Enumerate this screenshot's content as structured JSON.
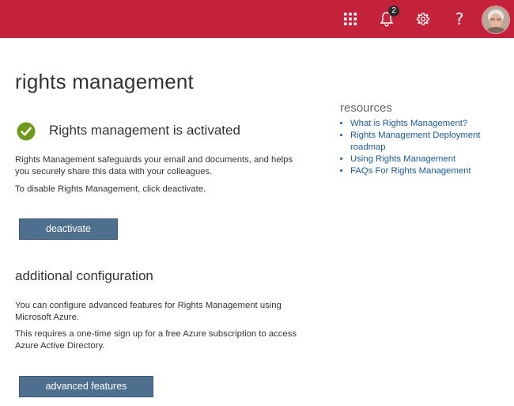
{
  "topbar": {
    "accent": "#c4213a",
    "icons": [
      "app-launcher-icon",
      "bell-icon",
      "gear-icon",
      "help-icon"
    ],
    "notification_count": "2",
    "help_glyph": "?"
  },
  "page": {
    "title": "rights management",
    "status": "Rights management is activated",
    "description": "Rights Management safeguards your email and documents, and helps you securely share this data with your colleagues.",
    "disable_hint": "To disable Rights Management, click deactivate.",
    "deactivate_label": "deactivate"
  },
  "additional": {
    "title": "additional configuration",
    "text1": "You can configure advanced features for Rights Management using Microsoft Azure.",
    "text2": "This requires a one-time sign up for a free Azure subscription to access Azure Active Directory.",
    "button_label": "advanced features"
  },
  "resources": {
    "title": "resources",
    "links": [
      "What is Rights Management?",
      "Rights Management Deployment roadmap",
      "Using Rights Management",
      "FAQs For Rights Management"
    ]
  }
}
